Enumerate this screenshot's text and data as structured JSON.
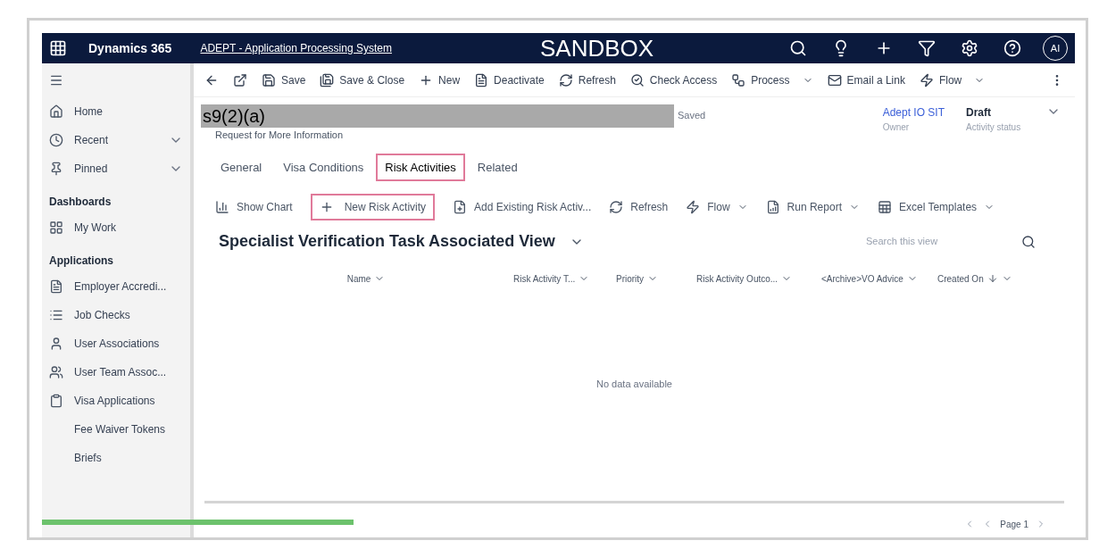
{
  "top_bar": {
    "product": "Dynamics 365",
    "app_name": "ADEPT - Application Processing System",
    "environment": "SANDBOX",
    "avatar": "AI"
  },
  "command_bar": [
    {
      "label": "Save",
      "menu": false
    },
    {
      "label": "Save & Close",
      "menu": false
    },
    {
      "label": "New",
      "menu": false
    },
    {
      "label": "Deactivate",
      "menu": false
    },
    {
      "label": "Refresh",
      "menu": false
    },
    {
      "label": "Check Access",
      "menu": false
    },
    {
      "label": "Process",
      "menu": true
    },
    {
      "label": "Email a Link",
      "menu": false
    },
    {
      "label": "Flow",
      "menu": true
    }
  ],
  "sidebar": {
    "items": [
      {
        "kind": "item",
        "label": "Home",
        "expandable": false
      },
      {
        "kind": "item",
        "label": "Recent",
        "expandable": true
      },
      {
        "kind": "item",
        "label": "Pinned",
        "expandable": true
      },
      {
        "kind": "heading",
        "label": "Dashboards"
      },
      {
        "kind": "item",
        "label": "My Work",
        "expandable": false
      },
      {
        "kind": "heading",
        "label": "Applications"
      },
      {
        "kind": "item",
        "label": "Employer Accredi...",
        "expandable": false
      },
      {
        "kind": "item",
        "label": "Job Checks",
        "expandable": false
      },
      {
        "kind": "item",
        "label": "User Associations",
        "expandable": false
      },
      {
        "kind": "item",
        "label": "User Team Assoc...",
        "expandable": false
      },
      {
        "kind": "item",
        "label": "Visa Applications",
        "expandable": false
      },
      {
        "kind": "item",
        "label": "Fee Waiver Tokens",
        "expandable": false
      },
      {
        "kind": "item",
        "label": "Briefs",
        "expandable": false
      }
    ]
  },
  "record": {
    "title": "s9(2)(a)",
    "save_status": "Saved",
    "entity": "Request for More Information",
    "owner": {
      "value": "Adept IO SIT",
      "label": "Owner"
    },
    "status": {
      "value": "Draft",
      "label": "Activity status"
    }
  },
  "tabs": [
    {
      "label": "General",
      "selected": false
    },
    {
      "label": "Visa Conditions",
      "selected": false
    },
    {
      "label": "Risk Activities",
      "selected": true
    },
    {
      "label": "Related",
      "selected": false
    }
  ],
  "grid_commands": [
    {
      "label": "Show Chart",
      "menu": false,
      "highlighted": false
    },
    {
      "label": "New Risk Activity",
      "menu": false,
      "highlighted": true
    },
    {
      "label": "Add Existing Risk Activ...",
      "menu": false,
      "highlighted": false
    },
    {
      "label": "Refresh",
      "menu": false,
      "highlighted": false
    },
    {
      "label": "Flow",
      "menu": true,
      "highlighted": false
    },
    {
      "label": "Run Report",
      "menu": true,
      "highlighted": false
    },
    {
      "label": "Excel Templates",
      "menu": true,
      "highlighted": false
    }
  ],
  "view": {
    "title": "Specialist Verification Task Associated View",
    "search": {
      "placeholder": "Search this view"
    }
  },
  "table": {
    "columns": [
      {
        "label": "Name",
        "sorted": false
      },
      {
        "label": "Risk Activity T...",
        "sorted": false
      },
      {
        "label": "Priority",
        "sorted": false
      },
      {
        "label": "Risk Activity Outco...",
        "sorted": false
      },
      {
        "label": "<Archive>VO Advice",
        "sorted": false
      },
      {
        "label": "Created On",
        "sorted": true
      }
    ],
    "empty_message": "No data available"
  },
  "paging": {
    "page": "Page 1"
  }
}
